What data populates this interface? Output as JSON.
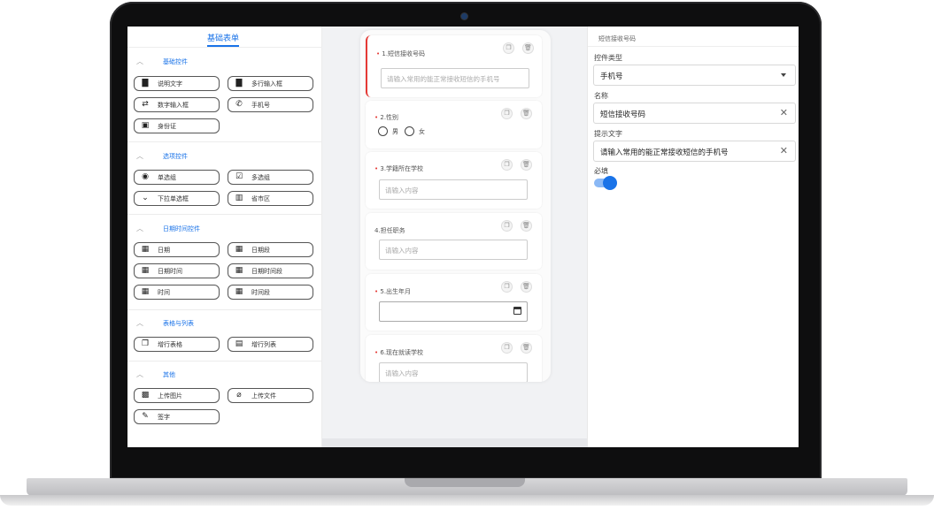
{
  "left_panel": {
    "tab": "基础表单",
    "sections": [
      {
        "title": "基础控件",
        "items": [
          {
            "label": "说明文字",
            "icon": "comment-icon"
          },
          {
            "label": "多行输入框",
            "icon": "comment-icon"
          },
          {
            "label": "数字输入框",
            "icon": "swap-icon"
          },
          {
            "label": "手机号",
            "icon": "phone-icon"
          },
          {
            "label": "身份证",
            "icon": "id-card-icon"
          }
        ]
      },
      {
        "title": "选项控件",
        "items": [
          {
            "label": "单选组",
            "icon": "radio-icon"
          },
          {
            "label": "多选组",
            "icon": "checkbox-icon"
          },
          {
            "label": "下拉单选框",
            "icon": "chevron-down-icon"
          },
          {
            "label": "省市区",
            "icon": "map-icon"
          }
        ]
      },
      {
        "title": "日期时间控件",
        "items": [
          {
            "label": "日期",
            "icon": "calendar-icon"
          },
          {
            "label": "日期段",
            "icon": "calendar-icon"
          },
          {
            "label": "日期时间",
            "icon": "calendar-icon"
          },
          {
            "label": "日期时间段",
            "icon": "calendar-icon"
          },
          {
            "label": "时间",
            "icon": "calendar-icon"
          },
          {
            "label": "时间段",
            "icon": "calendar-icon"
          }
        ]
      },
      {
        "title": "表格与列表",
        "items": [
          {
            "label": "增行表格",
            "icon": "copy-icon"
          },
          {
            "label": "增行列表",
            "icon": "list-icon"
          }
        ]
      },
      {
        "title": "其他",
        "items": [
          {
            "label": "上传图片",
            "icon": "image-icon"
          },
          {
            "label": "上传文件",
            "icon": "attachment-icon"
          },
          {
            "label": "签字",
            "icon": "pen-icon"
          }
        ]
      }
    ]
  },
  "form": {
    "fields": [
      {
        "label": "1.短信接收号码",
        "required": true,
        "placeholder": "请输入常用的能正常接收短信的手机号"
      },
      {
        "label": "2.性别",
        "required": true,
        "options": [
          "男",
          "女"
        ]
      },
      {
        "label": "3.学籍所在学校",
        "required": true,
        "placeholder": "请输入内容"
      },
      {
        "label": "4.担任职务",
        "required": false,
        "placeholder": "请输入内容"
      },
      {
        "label": "5.出生年月",
        "required": true
      },
      {
        "label": "6.现在就读学校",
        "required": true,
        "placeholder": "请输入内容"
      }
    ]
  },
  "props": {
    "title": "短信接收号码",
    "type_label": "控件类型",
    "type_value": "手机号",
    "name_label": "名称",
    "name_value": "短信接收号码",
    "hint_label": "提示文字",
    "hint_value": "请输入常用的能正常接收短信的手机号",
    "required_label": "必填",
    "required_on": true
  },
  "colors": {
    "accent": "#1a73e8",
    "required_mark": "#e53935"
  }
}
